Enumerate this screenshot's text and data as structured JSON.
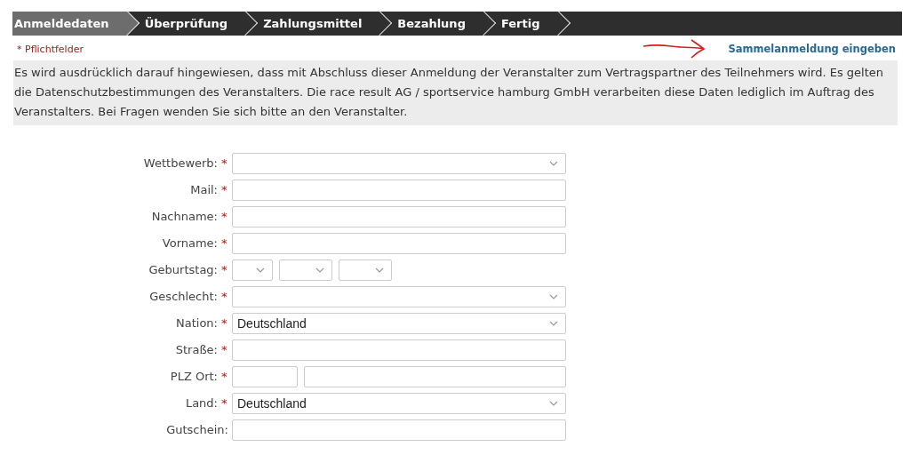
{
  "steps": [
    {
      "label": "Anmeldedaten",
      "selected": true
    },
    {
      "label": "Überprüfung",
      "selected": false
    },
    {
      "label": "Zahlungsmittel",
      "selected": false
    },
    {
      "label": "Bezahlung",
      "selected": false
    },
    {
      "label": "Fertig",
      "selected": false
    }
  ],
  "required_note": "* Pflichtfelder",
  "group_link": "Sammelanmeldung eingeben",
  "notice": "Es wird ausdrücklich darauf hingewiesen, dass mit Abschluss dieser Anmeldung der Veranstalter zum Vertragspartner des Teilnehmers wird. Es gelten die Datenschutzbestimmungen des Veranstalters. Die race result AG / sportservice hamburg GmbH verarbeiten diese Daten lediglich im Auftrag des Veranstalters. Bei Fragen wenden Sie sich bitte an den Veranstalter.",
  "fields": [
    {
      "label": "Wettbewerb:",
      "marker": "*",
      "kind": "select"
    },
    {
      "label": "Mail:",
      "marker": "*",
      "kind": "input"
    },
    {
      "label": "Nachname:",
      "marker": "*",
      "kind": "input"
    },
    {
      "label": "Vorname:",
      "marker": "*",
      "kind": "input"
    },
    {
      "label": "Geburtstag:",
      "marker": "*",
      "kind": "date"
    },
    {
      "label": "Geschlecht:",
      "marker": "*",
      "kind": "select"
    },
    {
      "label": "Nation:",
      "marker": "*",
      "kind": "select",
      "value": "Deutschland"
    },
    {
      "label": "Straße:",
      "marker": "*",
      "kind": "input"
    },
    {
      "label": "PLZ Ort:",
      "marker": "*",
      "kind": "split"
    },
    {
      "label": "Land:",
      "marker": "*",
      "kind": "select",
      "value": "Deutschland"
    },
    {
      "label": "Gutschein:",
      "kind": "input"
    }
  ]
}
